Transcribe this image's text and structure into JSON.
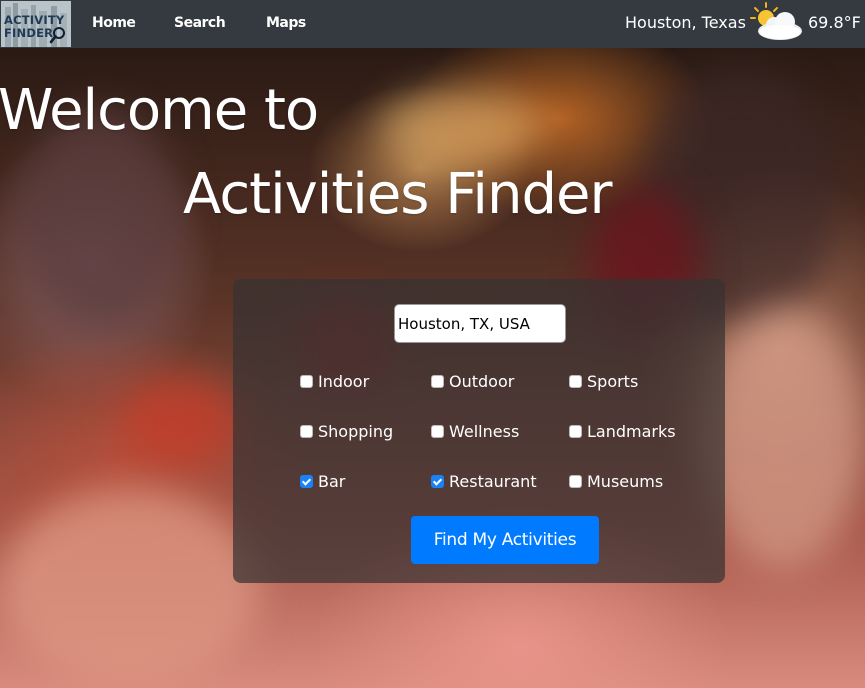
{
  "nav": {
    "logo_line1": "ACTIVITY",
    "logo_line2": "FINDER",
    "links": [
      "Home",
      "Search",
      "Maps"
    ],
    "weather": {
      "city": "Houston, Texas",
      "temp": "69.8°F",
      "icon": "partly-cloudy-icon"
    }
  },
  "hero": {
    "line1": "Welcome to",
    "line2": "Activities Finder"
  },
  "search": {
    "location_value": "Houston, TX, USA",
    "options": [
      {
        "label": "Indoor",
        "checked": false
      },
      {
        "label": "Outdoor",
        "checked": false
      },
      {
        "label": "Sports",
        "checked": false
      },
      {
        "label": "Shopping",
        "checked": false
      },
      {
        "label": "Wellness",
        "checked": false
      },
      {
        "label": "Landmarks",
        "checked": false
      },
      {
        "label": "Bar",
        "checked": true
      },
      {
        "label": "Restaurant",
        "checked": true
      },
      {
        "label": "Museums",
        "checked": false
      }
    ],
    "submit_label": "Find My Activities"
  },
  "colors": {
    "navbar": "#343a40",
    "accent": "#007bff"
  }
}
